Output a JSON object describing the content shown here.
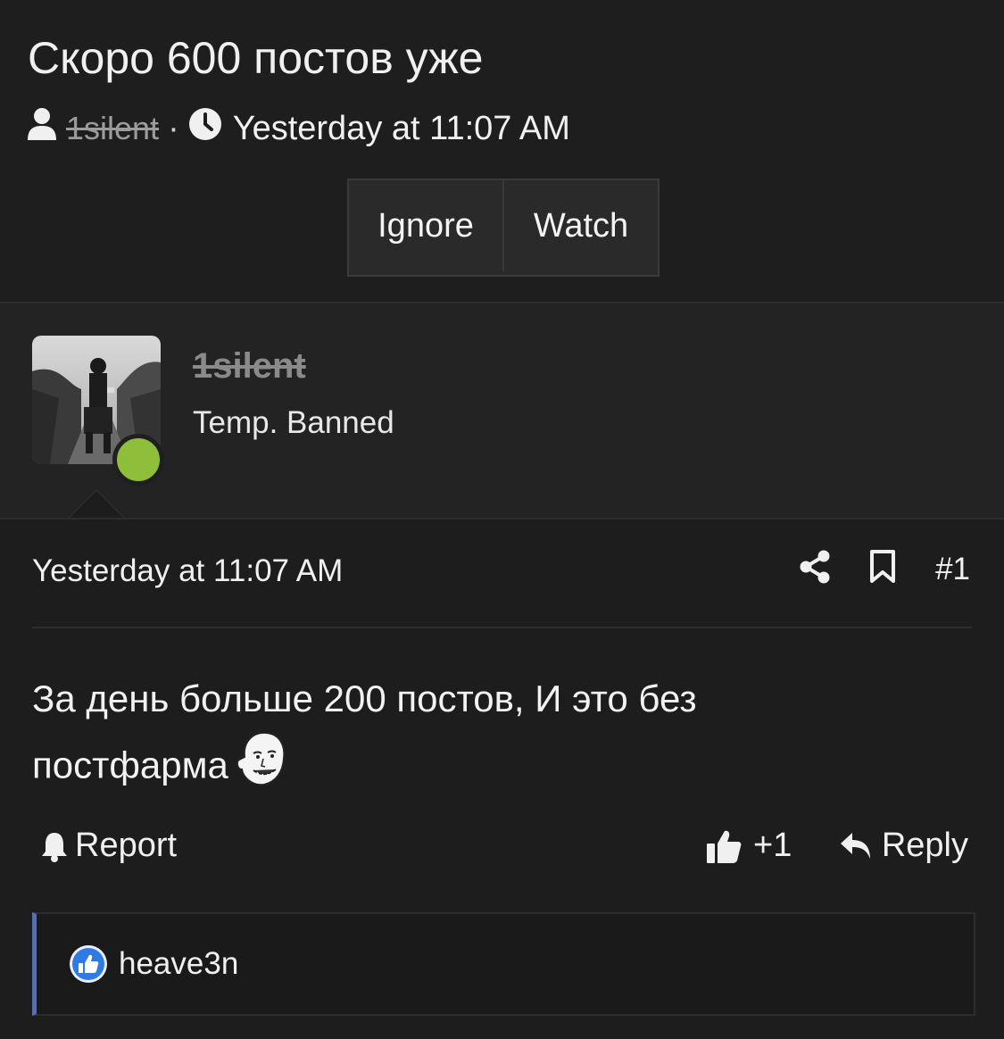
{
  "thread": {
    "title": "Скоро 600 постов уже",
    "author": "1silent",
    "separator": "·",
    "date": "Yesterday at 11:07 AM",
    "buttons": {
      "ignore": "Ignore",
      "watch": "Watch"
    }
  },
  "user": {
    "name": "1silent",
    "title": "Temp. Banned",
    "online_color": "#8fbe3a"
  },
  "post": {
    "date": "Yesterday at 11:07 AM",
    "number": "#1",
    "body_line1": "За день больше 200 постов, И это без",
    "body_line2": "постфарма",
    "smilie": "wojak-smile-emoji"
  },
  "footer": {
    "report": "Report",
    "like_count": "+1",
    "reply": "Reply"
  },
  "reactions": {
    "icon": "like-reaction-icon",
    "users": "heave3n",
    "accent": "#5a6fb0"
  }
}
